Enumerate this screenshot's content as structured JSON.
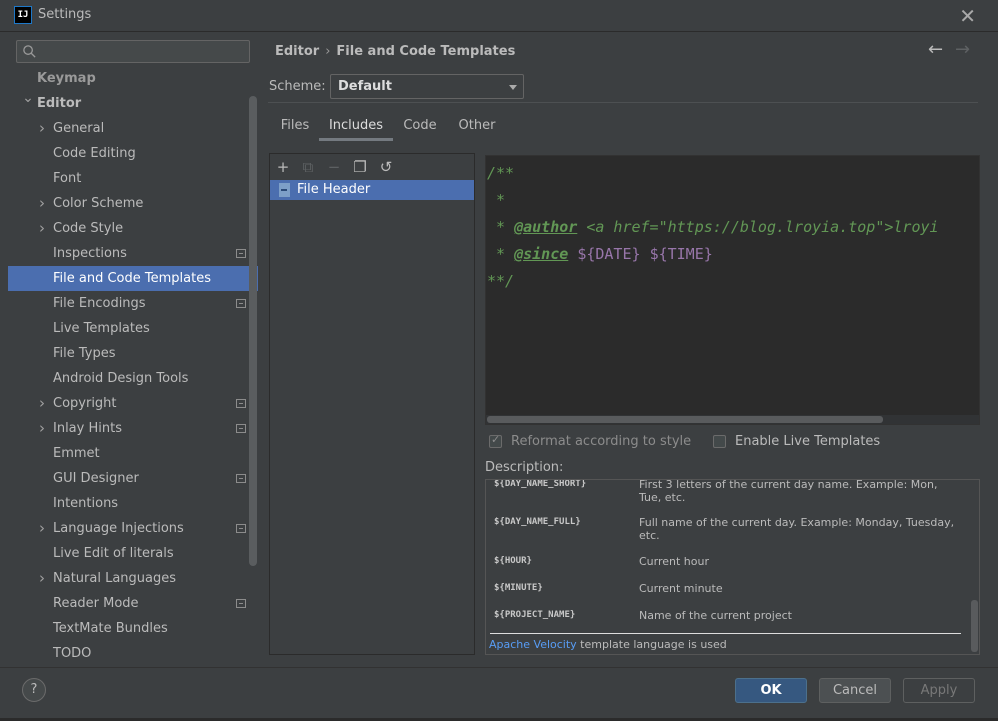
{
  "window": {
    "title": "Settings",
    "app_icon_text": "IJ"
  },
  "search": {
    "placeholder": "",
    "value": ""
  },
  "tree": {
    "items": [
      {
        "label": "Keymap",
        "depth": 0,
        "expandable": false,
        "state": "ghost"
      },
      {
        "label": "Editor",
        "depth": 0,
        "expandable": true,
        "expanded": true,
        "state": "bold"
      },
      {
        "label": "General",
        "depth": 1,
        "expandable": true
      },
      {
        "label": "Code Editing",
        "depth": 1,
        "expandable": false
      },
      {
        "label": "Font",
        "depth": 1,
        "expandable": false
      },
      {
        "label": "Color Scheme",
        "depth": 1,
        "expandable": true
      },
      {
        "label": "Code Style",
        "depth": 1,
        "expandable": true
      },
      {
        "label": "Inspections",
        "depth": 1,
        "expandable": false,
        "project_icon": true
      },
      {
        "label": "File and Code Templates",
        "depth": 1,
        "expandable": false,
        "selected": true
      },
      {
        "label": "File Encodings",
        "depth": 1,
        "expandable": false,
        "project_icon": true
      },
      {
        "label": "Live Templates",
        "depth": 1,
        "expandable": false
      },
      {
        "label": "File Types",
        "depth": 1,
        "expandable": false
      },
      {
        "label": "Android Design Tools",
        "depth": 1,
        "expandable": false
      },
      {
        "label": "Copyright",
        "depth": 1,
        "expandable": true,
        "project_icon": true
      },
      {
        "label": "Inlay Hints",
        "depth": 1,
        "expandable": true,
        "project_icon": true
      },
      {
        "label": "Emmet",
        "depth": 1,
        "expandable": false
      },
      {
        "label": "GUI Designer",
        "depth": 1,
        "expandable": false,
        "project_icon": true
      },
      {
        "label": "Intentions",
        "depth": 1,
        "expandable": false
      },
      {
        "label": "Language Injections",
        "depth": 1,
        "expandable": true,
        "project_icon": true
      },
      {
        "label": "Live Edit of literals",
        "depth": 1,
        "expandable": false
      },
      {
        "label": "Natural Languages",
        "depth": 1,
        "expandable": true
      },
      {
        "label": "Reader Mode",
        "depth": 1,
        "expandable": false,
        "project_icon": true
      },
      {
        "label": "TextMate Bundles",
        "depth": 1,
        "expandable": false
      },
      {
        "label": "TODO",
        "depth": 1,
        "expandable": false
      }
    ]
  },
  "breadcrumb": {
    "parent": "Editor",
    "separator": "›",
    "current": "File and Code Templates"
  },
  "nav": {
    "back": "←",
    "forward": "→"
  },
  "scheme": {
    "label": "Scheme:",
    "value": "Default"
  },
  "tabs": [
    {
      "label": "Files"
    },
    {
      "label": "Includes",
      "active": true
    },
    {
      "label": "Code"
    },
    {
      "label": "Other"
    }
  ],
  "toolbar": {
    "add": "+",
    "copy": "⧉",
    "remove": "−",
    "duplicate": "❐",
    "reset": "↺"
  },
  "templates": [
    {
      "label": "File Header",
      "selected": true
    }
  ],
  "editor": {
    "lines": [
      [
        {
          "t": "/**",
          "c": "comment"
        }
      ],
      [
        {
          "t": " *",
          "c": "comment"
        }
      ],
      [
        {
          "t": " * ",
          "c": "comment"
        },
        {
          "t": "@author",
          "c": "tag"
        },
        {
          "t": " <a href=\"https://blog.lroyia.top\">lroyi",
          "c": "comment"
        }
      ],
      [
        {
          "t": " * ",
          "c": "comment"
        },
        {
          "t": "@since",
          "c": "tag"
        },
        {
          "t": " ",
          "c": "comment"
        },
        {
          "t": "${DATE}",
          "c": "var"
        },
        {
          "t": " ",
          "c": "comment"
        },
        {
          "t": "${TIME}",
          "c": "var"
        }
      ],
      [
        {
          "t": "**/",
          "c": "comment"
        }
      ]
    ]
  },
  "options": {
    "reformat": {
      "label": "Reformat according to style",
      "checked": true,
      "disabled": true
    },
    "live_templates": {
      "label": "Enable Live Templates",
      "checked": false
    }
  },
  "description": {
    "label": "Description:",
    "rows": [
      {
        "key": "${DAY_NAME_SHORT}",
        "value": "First 3 letters of the current day name. Example: Mon, Tue, etc."
      },
      {
        "key": "${DAY_NAME_FULL}",
        "value": "Full name of the current day. Example: Monday, Tuesday, etc."
      },
      {
        "key": "${HOUR}",
        "value": "Current hour"
      },
      {
        "key": "${MINUTE}",
        "value": "Current minute"
      },
      {
        "key": "${PROJECT_NAME}",
        "value": "Name of the current project"
      }
    ],
    "footer_link": "Apache Velocity",
    "footer_text": " template language is used"
  },
  "buttons": {
    "help": "?",
    "ok": "OK",
    "cancel": "Cancel",
    "apply": "Apply"
  },
  "colors": {
    "selection": "#4b6eaf",
    "background": "#3c3f41",
    "editor_bg": "#2b2b2b",
    "comment": "#629755",
    "variable": "#9876aa",
    "link": "#589df6"
  }
}
